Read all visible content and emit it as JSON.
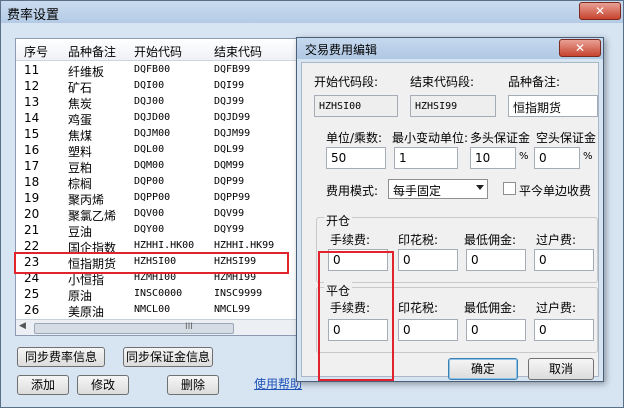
{
  "outer": {
    "title": "费率设置",
    "close_glyph": "✕",
    "columns": [
      "序号",
      "品种备注",
      "开始代码",
      "结束代码"
    ],
    "rows": [
      {
        "no": "11",
        "name": "纤维板",
        "start": "DQFB00",
        "end": "DQFB99"
      },
      {
        "no": "12",
        "name": "矿石",
        "start": "DQI00",
        "end": "DQI99"
      },
      {
        "no": "13",
        "name": "焦炭",
        "start": "DQJ00",
        "end": "DQJ99"
      },
      {
        "no": "14",
        "name": "鸡蛋",
        "start": "DQJD00",
        "end": "DQJD99"
      },
      {
        "no": "15",
        "name": "焦煤",
        "start": "DQJM00",
        "end": "DQJM99"
      },
      {
        "no": "16",
        "name": "塑料",
        "start": "DQL00",
        "end": "DQL99"
      },
      {
        "no": "17",
        "name": "豆粕",
        "start": "DQM00",
        "end": "DQM99"
      },
      {
        "no": "18",
        "name": "棕榈",
        "start": "DQP00",
        "end": "DQP99"
      },
      {
        "no": "19",
        "name": "聚丙烯",
        "start": "DQPP00",
        "end": "DQPP99"
      },
      {
        "no": "20",
        "name": "聚氯乙烯",
        "start": "DQV00",
        "end": "DQV99"
      },
      {
        "no": "21",
        "name": "豆油",
        "start": "DQY00",
        "end": "DQY99"
      },
      {
        "no": "22",
        "name": "国企指数",
        "start": "HZHHI.HK00",
        "end": "HZHHI.HK99"
      },
      {
        "no": "23",
        "name": "恒指期货",
        "start": "HZHSI00",
        "end": "HZHSI99"
      },
      {
        "no": "24",
        "name": "小恒指",
        "start": "HZMHI00",
        "end": "HZMHI99"
      },
      {
        "no": "25",
        "name": "原油",
        "start": "INSC0000",
        "end": "INSC9999"
      },
      {
        "no": "26",
        "name": "美原油",
        "start": "NMCL00",
        "end": "NMCL99"
      }
    ],
    "scroll_left": "◀",
    "scroll_mid": "III",
    "buttons": {
      "sync_rate": "同步费率信息",
      "sync_margin": "同步保证金信息",
      "add": "添加",
      "modify": "修改",
      "delete": "删除"
    },
    "help_link": "使用帮助"
  },
  "dialog": {
    "title": "交易费用编辑",
    "close_glyph": "✕",
    "labels": {
      "start_code": "开始代码段:",
      "end_code": "结束代码段:",
      "remark": "品种备注:",
      "unit": "单位/乘数:",
      "min_tick": "最小变动单位:",
      "long_margin": "多头保证金",
      "short_margin": "空头保证金",
      "fee_mode": "费用模式:",
      "flat_single": "平今单边收费",
      "pct": "%"
    },
    "values": {
      "start_code": "HZHSI00",
      "end_code": "HZHSI99",
      "remark": "恒指期货",
      "unit": "50",
      "min_tick": "1",
      "long_margin": "10",
      "short_margin": "0",
      "fee_mode": "每手固定"
    },
    "open": {
      "title": "开仓",
      "fee_label": "手续费:",
      "stamp_label": "印花税:",
      "min_comm_label": "最低佣金:",
      "transfer_label": "过户费:",
      "fee": "0",
      "stamp": "0",
      "min_comm": "0",
      "transfer": "0"
    },
    "close": {
      "title": "平仓",
      "fee_label": "手续费:",
      "stamp_label": "印花税:",
      "min_comm_label": "最低佣金:",
      "transfer_label": "过户费:",
      "fee": "0",
      "stamp": "0",
      "min_comm": "0",
      "transfer": "0"
    },
    "ok": "确定",
    "cancel": "取消"
  }
}
